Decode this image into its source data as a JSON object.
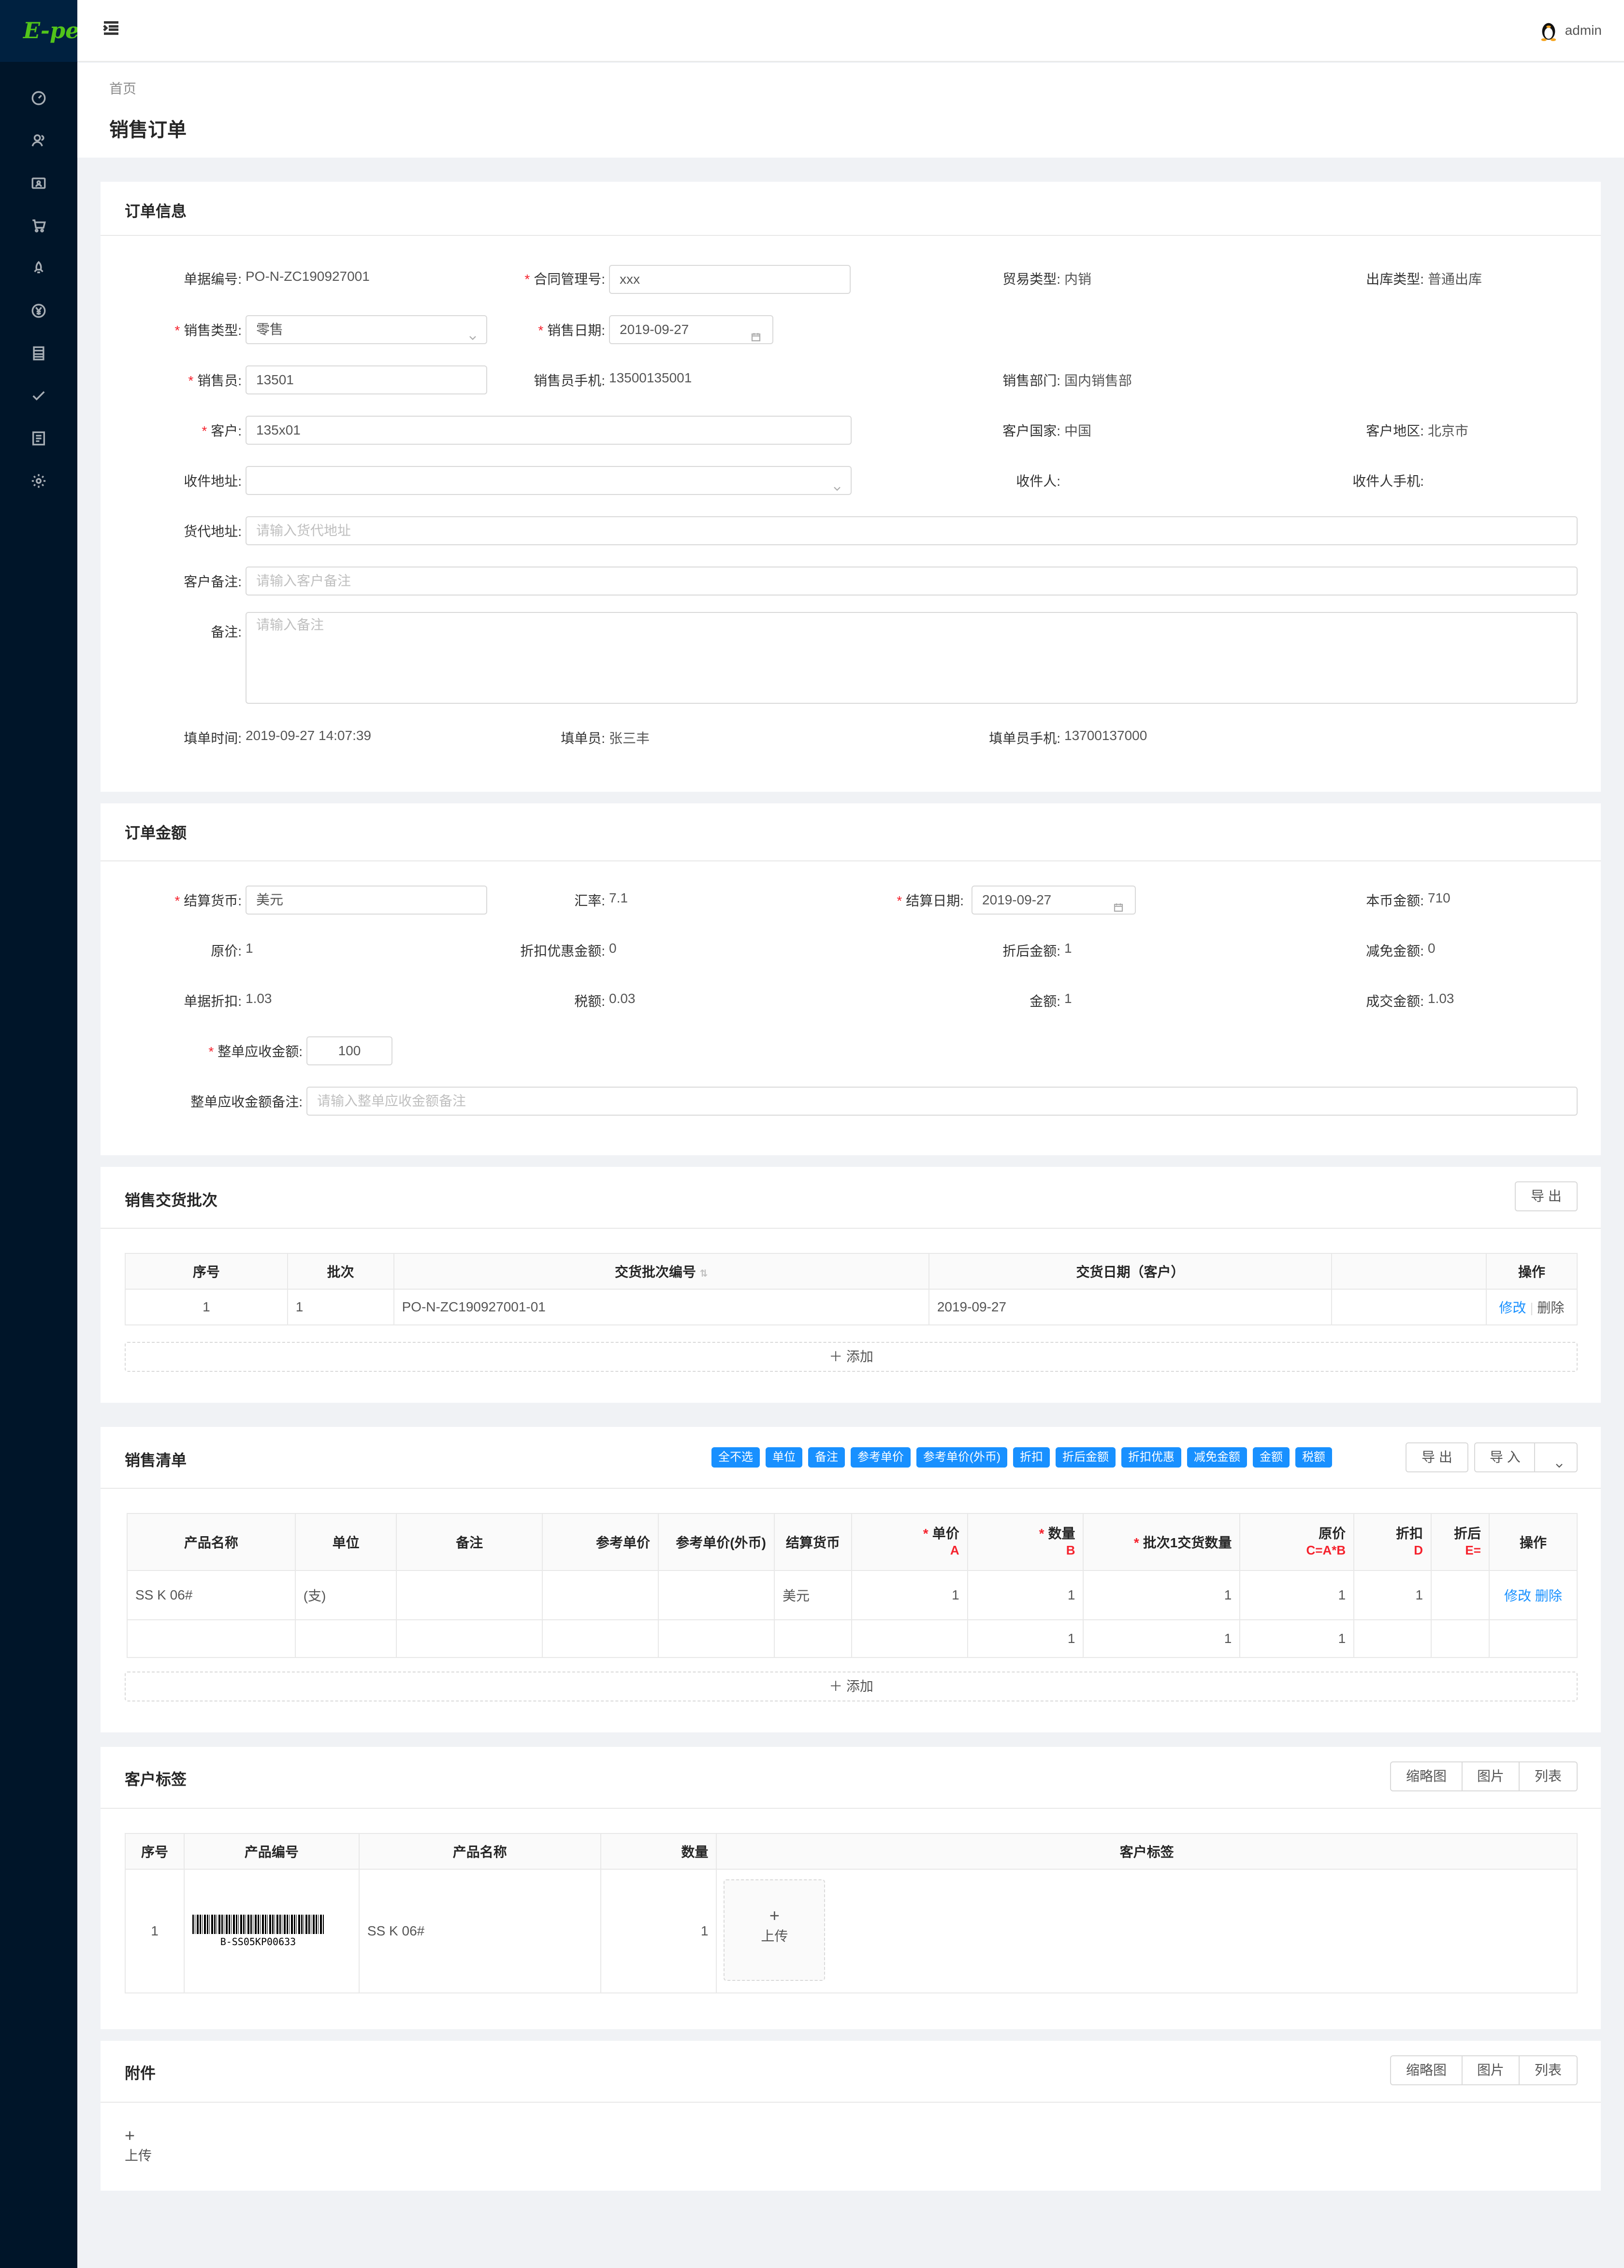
{
  "app": {
    "logo_text": "E-pen",
    "user_name": "admin"
  },
  "page": {
    "breadcrumb": "首页",
    "title": "销售订单"
  },
  "order_info": {
    "title": "订单信息",
    "doc_no_label": "单据编号:",
    "doc_no": "PO-N-ZC190927001",
    "contract_label": "合同管理号:",
    "contract": "xxx",
    "trade_type_label": "贸易类型:",
    "trade_type": "内销",
    "out_type_label": "出库类型:",
    "out_type": "普通出库",
    "sale_type_label": "销售类型:",
    "sale_type": "零售",
    "sale_date_label": "销售日期:",
    "sale_date": "2019-09-27",
    "salesman_label": "销售员:",
    "salesman": "13501",
    "salesman_phone_label": "销售员手机:",
    "salesman_phone": "13500135001",
    "dept_label": "销售部门:",
    "dept": "国内销售部",
    "customer_label": "客户:",
    "customer": "135x01",
    "country_label": "客户国家:",
    "country": "中国",
    "region_label": "客户地区:",
    "region": "北京市",
    "address_label": "收件地址:",
    "receiver_label": "收件人:",
    "receiver_phone_label": "收件人手机:",
    "forwarder_label": "货代地址:",
    "forwarder_ph": "请输入货代地址",
    "cust_remark_label": "客户备注:",
    "cust_remark_ph": "请输入客户备注",
    "remark_label": "备注:",
    "remark_ph": "请输入备注",
    "fill_time_label": "填单时间:",
    "fill_time": "2019-09-27 14:07:39",
    "filler_label": "填单员:",
    "filler": "张三丰",
    "filler_phone_label": "填单员手机:",
    "filler_phone": "13700137000"
  },
  "amount": {
    "title": "订单金额",
    "currency_label": "结算货币:",
    "currency": "美元",
    "rate_label": "汇率:",
    "rate": "7.1",
    "settle_date_label": "结算日期:",
    "settle_date": "2019-09-27",
    "local_amount_label": "本币金额:",
    "local_amount": "710",
    "orig_price_label": "原价:",
    "orig_price": "1",
    "discount_amount_label": "折扣优惠金额:",
    "discount_amount": "0",
    "after_discount_label": "折后金额:",
    "after_discount": "1",
    "reduce_label": "减免金额:",
    "reduce": "0",
    "doc_discount_label": "单据折扣:",
    "doc_discount": "1.03",
    "tax_label": "税额:",
    "tax": "0.03",
    "money_label": "金额:",
    "money": "1",
    "deal_label": "成交金额:",
    "deal": "1.03",
    "receivable_label": "整单应收金额:",
    "receivable": "100",
    "receivable_remark_label": "整单应收金额备注:",
    "receivable_remark_ph": "请输入整单应收金额备注"
  },
  "batches": {
    "title": "销售交货批次",
    "export_label": "导 出",
    "headers": [
      "序号",
      "批次",
      "交货批次编号",
      "交货日期（客户）",
      "",
      "操作"
    ],
    "row": {
      "seq": "1",
      "batch": "1",
      "code": "PO-N-ZC190927001-01",
      "date": "2019-09-27",
      "edit": "修改",
      "del": "删除"
    },
    "add_label": "添加"
  },
  "sales_list": {
    "title": "销售清单",
    "tags": [
      "全不选",
      "单位",
      "备注",
      "参考单价",
      "参考单价(外币)",
      "折扣",
      "折后金额",
      "折扣优惠",
      "减免金额",
      "金额",
      "税额"
    ],
    "export_label": "导 出",
    "import_label": "导 入",
    "headers": [
      "产品名称",
      "单位",
      "备注",
      "参考单价",
      "参考单价(外币)",
      "结算货币",
      "单价",
      "数量",
      "批次1交货数量",
      "原价",
      "折扣",
      "折后",
      "操作"
    ],
    "sub_headers": {
      "price": "A",
      "qty": "B",
      "orig": "C=A*B",
      "disc": "D",
      "after": "E="
    },
    "row1": {
      "name": "SS K 06#",
      "unit": "(支)",
      "currency": "美元",
      "price": "1",
      "qty": "1",
      "batch_qty": "1",
      "orig": "1",
      "disc": "1",
      "edit": "修改",
      "del": "删除"
    },
    "row2": {
      "qty": "1",
      "batch_qty": "1",
      "orig": "1"
    },
    "add_label": "添加"
  },
  "cust_tags": {
    "title": "客户标签",
    "views": [
      "缩略图",
      "图片",
      "列表"
    ],
    "headers": [
      "序号",
      "产品编号",
      "产品名称",
      "数量",
      "客户标签"
    ],
    "row": {
      "seq": "1",
      "barcode": "B-SS05KP00633",
      "name": "SS K 06#",
      "qty": "1"
    },
    "upload_label": "上传"
  },
  "attachments": {
    "title": "附件",
    "views": [
      "缩略图",
      "图片",
      "列表"
    ],
    "upload_label": "上传"
  }
}
